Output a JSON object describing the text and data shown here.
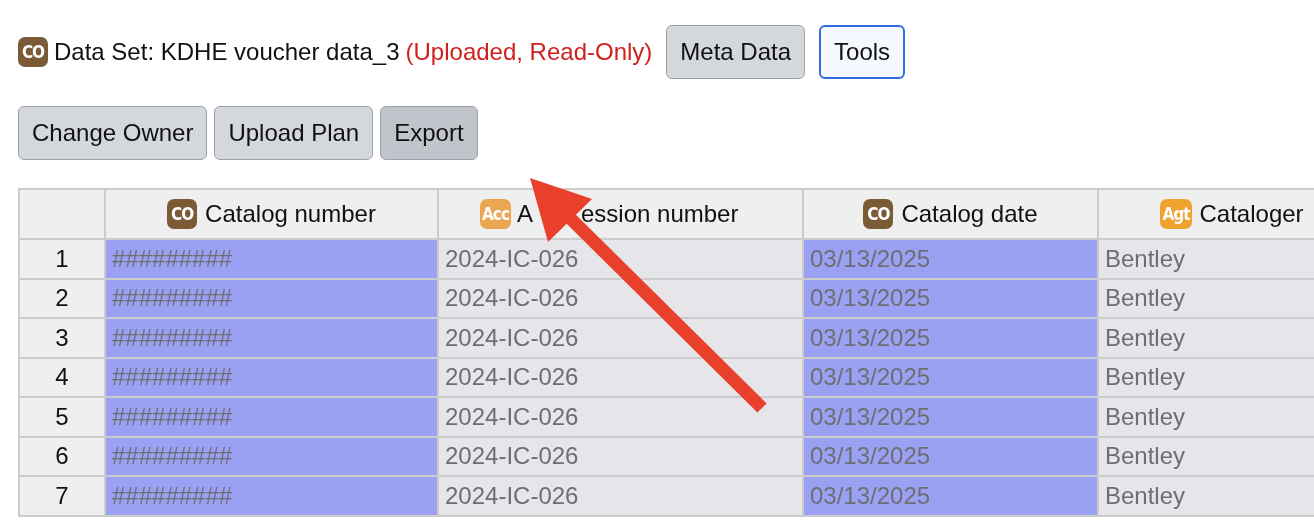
{
  "header": {
    "badge": {
      "text": "CO",
      "color": "#7b5a36"
    },
    "title": "Data Set: KDHE voucher data_3",
    "status": "(Uploaded, Read-Only)"
  },
  "header_buttons": [
    {
      "label": "Meta Data",
      "focused": false,
      "pressed": false
    },
    {
      "label": "Tools",
      "focused": true,
      "pressed": false
    }
  ],
  "toolbar_buttons": [
    {
      "label": "Change Owner",
      "focused": false,
      "pressed": false
    },
    {
      "label": "Upload Plan",
      "focused": false,
      "pressed": false
    },
    {
      "label": "Export",
      "focused": false,
      "pressed": true
    }
  ],
  "table": {
    "columns": [
      {
        "label": "Catalog number",
        "badge": {
          "text": "CO",
          "color": "#7b5a36"
        },
        "selected": true
      },
      {
        "label_parts": [
          "A",
          "ession number"
        ],
        "badge": {
          "text": "Acc",
          "color": "#eaa650"
        },
        "selected": false
      },
      {
        "label": "Catalog date",
        "badge": {
          "text": "CO",
          "color": "#7b5a36"
        },
        "selected": true
      },
      {
        "label": "Cataloger",
        "badge": {
          "text": "Agt",
          "color": "#f0a22e"
        },
        "selected": false
      }
    ],
    "rows": [
      {
        "number": "1",
        "cells": [
          "#########",
          "2024-IC-026",
          "03/13/2025",
          "Bentley"
        ]
      },
      {
        "number": "2",
        "cells": [
          "#########",
          "2024-IC-026",
          "03/13/2025",
          "Bentley"
        ]
      },
      {
        "number": "3",
        "cells": [
          "#########",
          "2024-IC-026",
          "03/13/2025",
          "Bentley"
        ]
      },
      {
        "number": "4",
        "cells": [
          "#########",
          "2024-IC-026",
          "03/13/2025",
          "Bentley"
        ]
      },
      {
        "number": "5",
        "cells": [
          "#########",
          "2024-IC-026",
          "03/13/2025",
          "Bentley"
        ]
      },
      {
        "number": "6",
        "cells": [
          "#########",
          "2024-IC-026",
          "03/13/2025",
          "Bentley"
        ]
      },
      {
        "number": "7",
        "cells": [
          "#########",
          "2024-IC-026",
          "03/13/2025",
          "Bentley"
        ]
      }
    ]
  },
  "annotation": {
    "kind": "arrow"
  }
}
